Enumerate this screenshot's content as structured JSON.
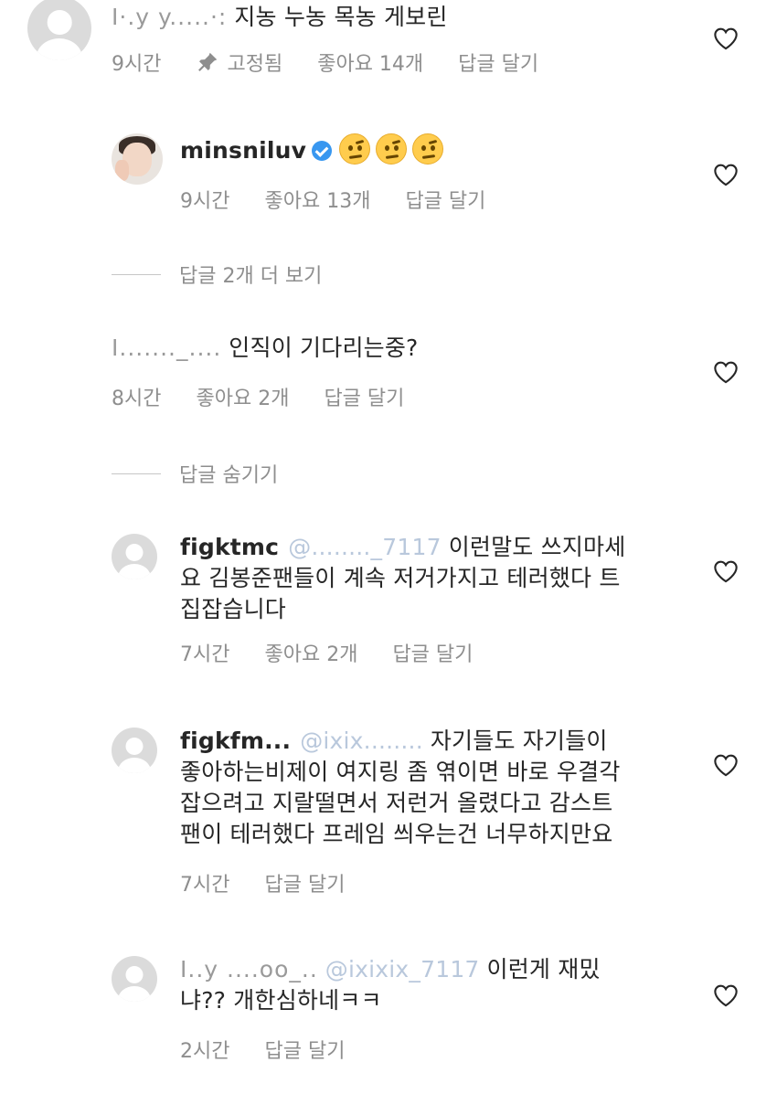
{
  "comments": [
    {
      "redacted_prefix": "I·.y y.....·:",
      "text": "지농 누농 목농 게보린",
      "time": "9시간",
      "pinned_label": "고정됨",
      "likes": "좋아요 14개",
      "reply": "답글 달기"
    },
    {
      "username": "minsniluv",
      "verified": true,
      "emoji_count": 3,
      "time": "9시간",
      "likes": "좋아요 13개",
      "reply": "답글 달기",
      "thread_link": "답글 2개 더 보기"
    },
    {
      "redacted_prefix": "I......._....",
      "text": "인직이 기다리는중?",
      "time": "8시간",
      "likes": "좋아요 2개",
      "reply": "답글 달기",
      "thread_link": "답글 숨기기"
    },
    {
      "username": "figktmc",
      "mention": "@........_7117",
      "line1": "이런말도 쓰지마세",
      "line2": "요 김봉준팬들이 계속 저거가지고 테러했다 트",
      "line3": "집잡습니다",
      "time": "7시간",
      "likes": "좋아요 2개",
      "reply": "답글 달기"
    },
    {
      "username": "figkfm...",
      "mention": "@ixix........",
      "line1": "자기들도 자기들이",
      "line2": "좋아하는비제이 여지링 좀 엮이면 바로 우결각",
      "line3": "잡으려고 지랄떨면서 저런거 올렸다고 감스트",
      "line4": "팬이 테러했다 프레임 씌우는건 너무하지만요",
      "time": "7시간",
      "reply": "답글 달기"
    },
    {
      "redacted_prefix": "I..y ....oo_..",
      "mention": "@ixixix_7117",
      "line1": "이런게 재밌",
      "line2": "냐?? 개한심하네ㅋㅋ",
      "time": "2시간",
      "reply": "답글 달기"
    }
  ],
  "icons": {
    "like": "heart-outline-icon",
    "pin": "pin-icon",
    "verified": "verified-badge-icon",
    "avatar_default": "default-avatar-icon"
  },
  "colors": {
    "text": "#262626",
    "meta": "#8e8e8e",
    "verified": "#3897f0",
    "mention": "#b9c8dc"
  }
}
